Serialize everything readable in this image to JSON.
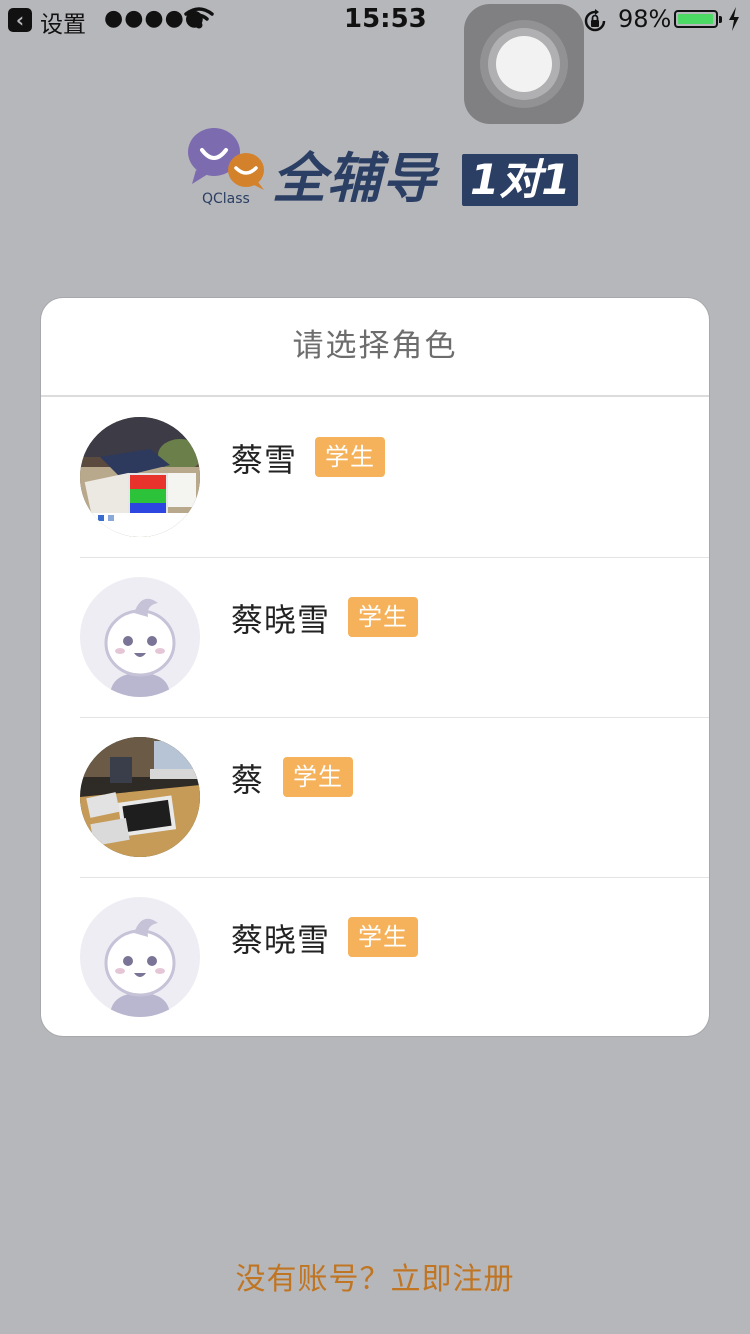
{
  "status_bar": {
    "back_app": "设置",
    "signal": "●●●●●",
    "time": "15:53",
    "battery_percent": "98%",
    "battery_level": 0.98
  },
  "logo": {
    "wordmark": "全辅导",
    "badge": "1对1",
    "sub": "QClass"
  },
  "role_card": {
    "title": "请选择角色",
    "roles": [
      {
        "name": "蔡雪",
        "badge": "学生",
        "avatar": "photo-avatar"
      },
      {
        "name": "蔡晓雪",
        "badge": "学生",
        "avatar": "default-avatar"
      },
      {
        "name": "蔡",
        "badge": "学生",
        "avatar": "photo-avatar"
      },
      {
        "name": "蔡晓雪",
        "badge": "学生",
        "avatar": "default-avatar"
      }
    ]
  },
  "register_link": "没有账号？立即注册",
  "colors": {
    "background": "#b6b7bb",
    "badge": "#f5b25b",
    "register_link": "#c07522",
    "logo_navy": "#2b3e63",
    "logo_purple": "#7d6bb0",
    "logo_orange": "#d3822b"
  }
}
